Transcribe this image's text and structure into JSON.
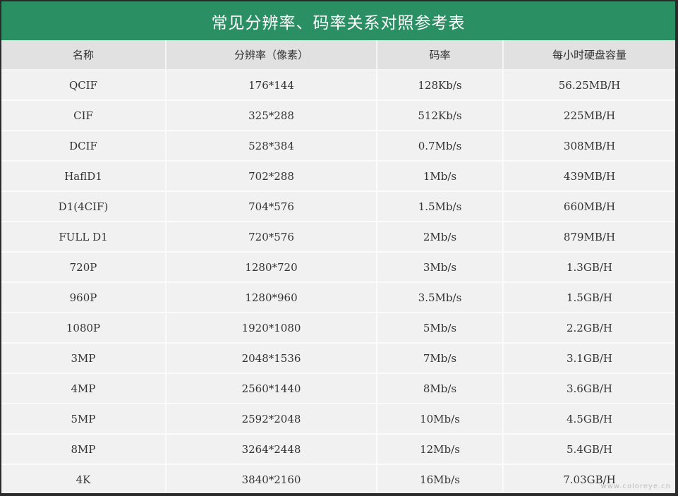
{
  "title": "常见分辨率、码率关系对照参考表",
  "headers": [
    "名称",
    "分辨率（像素）",
    "码率",
    "每小时硬盘容量"
  ],
  "rows": [
    [
      "QCIF",
      "176*144",
      "128Kb/s",
      "56.25MB/H"
    ],
    [
      "CIF",
      "325*288",
      "512Kb/s",
      "225MB/H"
    ],
    [
      "DCIF",
      "528*384",
      "0.7Mb/s",
      "308MB/H"
    ],
    [
      "HaflD1",
      "702*288",
      "1Mb/s",
      "439MB/H"
    ],
    [
      "D1(4CIF)",
      "704*576",
      "1.5Mb/s",
      "660MB/H"
    ],
    [
      "FULL D1",
      "720*576",
      "2Mb/s",
      "879MB/H"
    ],
    [
      "720P",
      "1280*720",
      "3Mb/s",
      "1.3GB/H"
    ],
    [
      "960P",
      "1280*960",
      "3.5Mb/s",
      "1.5GB/H"
    ],
    [
      "1080P",
      "1920*1080",
      "5Mb/s",
      "2.2GB/H"
    ],
    [
      "3MP",
      "2048*1536",
      "7Mb/s",
      "3.1GB/H"
    ],
    [
      "4MP",
      "2560*1440",
      "8Mb/s",
      "3.6GB/H"
    ],
    [
      "5MP",
      "2592*2048",
      "10Mb/s",
      "4.5GB/H"
    ],
    [
      "8MP",
      "3264*2448",
      "12Mb/s",
      "5.4GB/H"
    ],
    [
      "4K",
      "3840*2160",
      "16Mb/s",
      "7.03GB/H"
    ]
  ],
  "watermark": "www.coloreye.cn",
  "colors": {
    "title_bg": "#2a8f63",
    "header_bg": "#e1e1e1",
    "cell_bg": "#f1f1f1",
    "outer_bg": "#2b2b2b"
  }
}
